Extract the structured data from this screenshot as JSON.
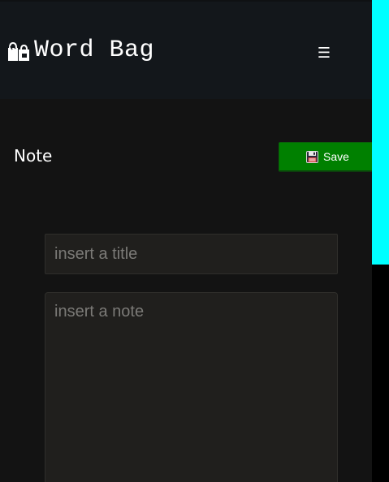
{
  "header": {
    "brand_title": "Word Bag",
    "brand_icon": "word-bag-logo-icon",
    "menu_icon": "hamburger-menu-icon",
    "menu_glyph": "☰"
  },
  "editor": {
    "heading": "Note",
    "save_label": "Save",
    "save_icon": "floppy-disk-icon",
    "title_placeholder": "insert a title",
    "note_placeholder": "insert a note",
    "title_value": "",
    "note_value": ""
  },
  "colors": {
    "background": "#131313",
    "topbar": "#13171b",
    "save_button": "#008000",
    "scrollbar_thumb": "#00ffff",
    "input_background": "#201f1d"
  }
}
